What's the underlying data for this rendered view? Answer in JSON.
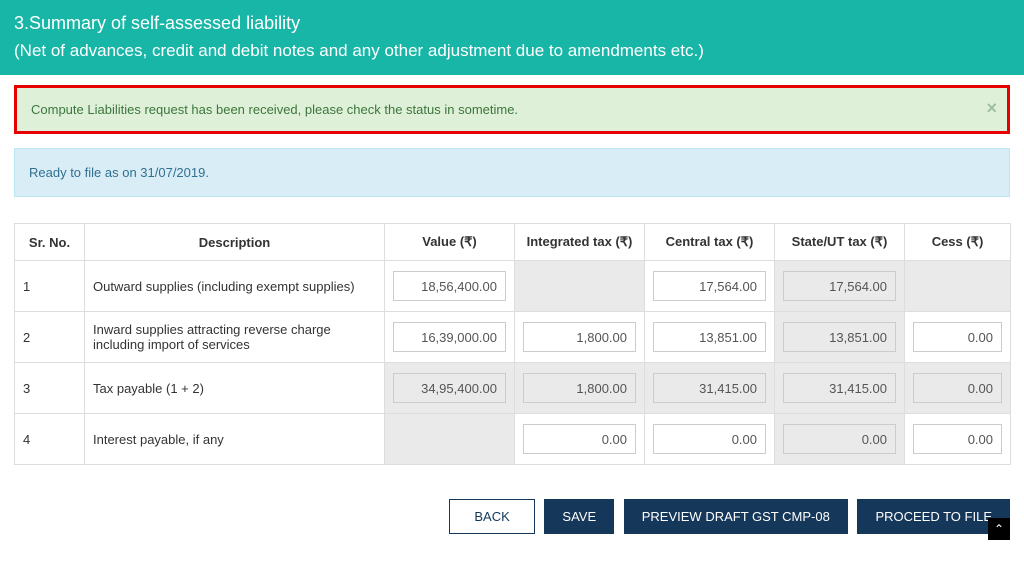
{
  "header": {
    "title": "3.Summary of self-assessed liability",
    "subtitle": "(Net of advances, credit and debit notes and any other adjustment due to amendments etc.)"
  },
  "alerts": {
    "success": "Compute Liabilities request has been received, please check the status in sometime.",
    "close_glyph": "×",
    "info": "Ready to file as on 31/07/2019."
  },
  "table": {
    "headers": {
      "sr": "Sr. No.",
      "desc": "Description",
      "value": "Value (₹)",
      "igst": "Integrated tax (₹)",
      "cgst": "Central tax (₹)",
      "sgst": "State/UT tax (₹)",
      "cess": "Cess (₹)"
    },
    "rows": [
      {
        "sr": "1",
        "desc": "Outward supplies (including exempt supplies)",
        "value": "18,56,400.00",
        "igst": "",
        "cgst": "17,564.00",
        "sgst": "17,564.00",
        "cess": ""
      },
      {
        "sr": "2",
        "desc": "Inward supplies attracting reverse charge including import of services",
        "value": "16,39,000.00",
        "igst": "1,800.00",
        "cgst": "13,851.00",
        "sgst": "13,851.00",
        "cess": "0.00"
      },
      {
        "sr": "3",
        "desc": "Tax payable (1 + 2)",
        "value": "34,95,400.00",
        "igst": "1,800.00",
        "cgst": "31,415.00",
        "sgst": "31,415.00",
        "cess": "0.00"
      },
      {
        "sr": "4",
        "desc": "Interest payable, if any",
        "value": "",
        "igst": "0.00",
        "cgst": "0.00",
        "sgst": "0.00",
        "cess": "0.00"
      }
    ]
  },
  "buttons": {
    "back": "BACK",
    "save": "SAVE",
    "preview": "PREVIEW DRAFT GST CMP-08",
    "proceed": "PROCEED TO FILE"
  },
  "caret_glyph": "⌃"
}
